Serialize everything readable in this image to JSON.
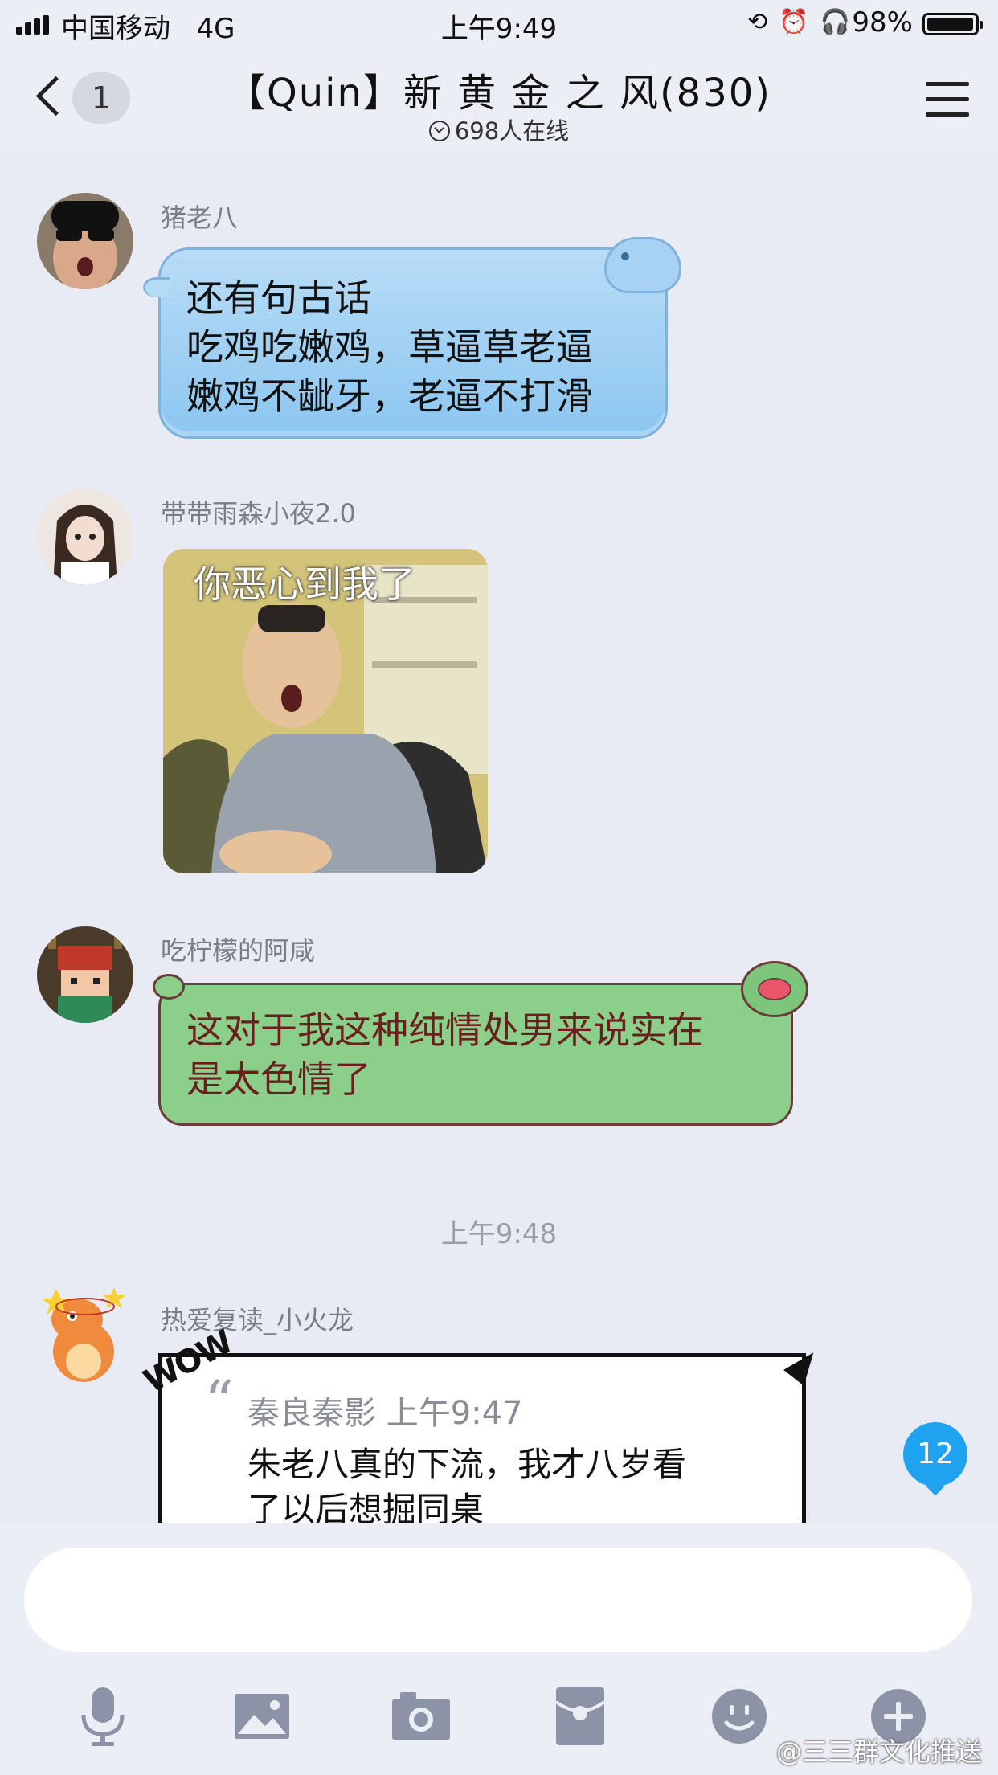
{
  "status_bar": {
    "carrier": "中国移动",
    "network": "4G",
    "time": "上午9:49",
    "battery_percent": "98%",
    "battery_level": 0.98
  },
  "header": {
    "back_badge": "1",
    "title": "【Quin】新 黄 金 之 风(830)",
    "online": "698人在线"
  },
  "messages": [
    {
      "sender": "猪老八",
      "lines": [
        "还有句古话",
        "吃鸡吃嫩鸡，草逼草老逼",
        "嫩鸡不龇牙，老逼不打滑"
      ]
    },
    {
      "sender": "带带雨森小夜2.0",
      "image_caption": "你恶心到我了"
    },
    {
      "sender": "吃柠檬的阿咸",
      "lines": [
        "这对于我这种纯情处男来说实在",
        "是太色情了"
      ]
    },
    {
      "time_divider": "上午9:48"
    },
    {
      "sender": "热爱复读_小火龙",
      "sticker_text": "WOW",
      "quote_header": "秦良秦影 上午9:47",
      "quote_lines": [
        "朱老八真的下流，我才八岁看",
        "了以后想掘同桌"
      ]
    }
  ],
  "new_message_count": "12",
  "input": {
    "placeholder": "",
    "value": ""
  },
  "toolbar": [
    "microphone-icon",
    "image-icon",
    "camera-icon",
    "red-packet-icon",
    "emoji-icon",
    "plus-icon"
  ],
  "watermark": "@三三群文化推送"
}
